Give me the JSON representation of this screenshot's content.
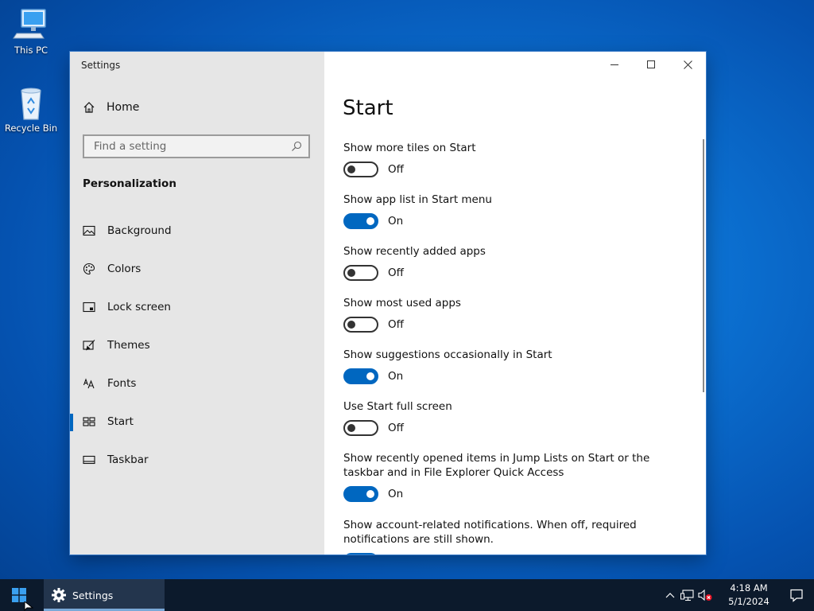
{
  "desktop": {
    "icons": [
      {
        "label": "This PC"
      },
      {
        "label": "Recycle Bin"
      }
    ]
  },
  "window": {
    "title": "Settings",
    "sidebar": {
      "home_label": "Home",
      "search_placeholder": "Find a setting",
      "section_heading": "Personalization",
      "items": [
        {
          "label": "Background",
          "icon": "picture-icon"
        },
        {
          "label": "Colors",
          "icon": "palette-icon"
        },
        {
          "label": "Lock screen",
          "icon": "lock-screen-icon"
        },
        {
          "label": "Themes",
          "icon": "themes-brush-icon"
        },
        {
          "label": "Fonts",
          "icon": "fonts-icon"
        },
        {
          "label": "Start",
          "icon": "start-icon",
          "selected": true
        },
        {
          "label": "Taskbar",
          "icon": "taskbar-icon"
        }
      ]
    },
    "content": {
      "title": "Start",
      "settings": [
        {
          "label": "Show more tiles on Start",
          "state": "Off"
        },
        {
          "label": "Show app list in Start menu",
          "state": "On"
        },
        {
          "label": "Show recently added apps",
          "state": "Off"
        },
        {
          "label": "Show most used apps",
          "state": "Off"
        },
        {
          "label": "Show suggestions occasionally in Start",
          "state": "On"
        },
        {
          "label": "Use Start full screen",
          "state": "Off"
        },
        {
          "label": "Show recently opened items in Jump Lists on Start or the taskbar and in File Explorer Quick Access",
          "state": "On"
        },
        {
          "label": "Show account-related notifications. When off, required notifications are still shown.",
          "state": "On"
        }
      ]
    }
  },
  "taskbar": {
    "app_label": "Settings",
    "time": "4:18 AM",
    "date": "5/1/2024"
  },
  "colors": {
    "accent": "#0067c0",
    "sidebar_bg": "#e6e6e6",
    "taskbar_bg": "#0c1a2c"
  }
}
